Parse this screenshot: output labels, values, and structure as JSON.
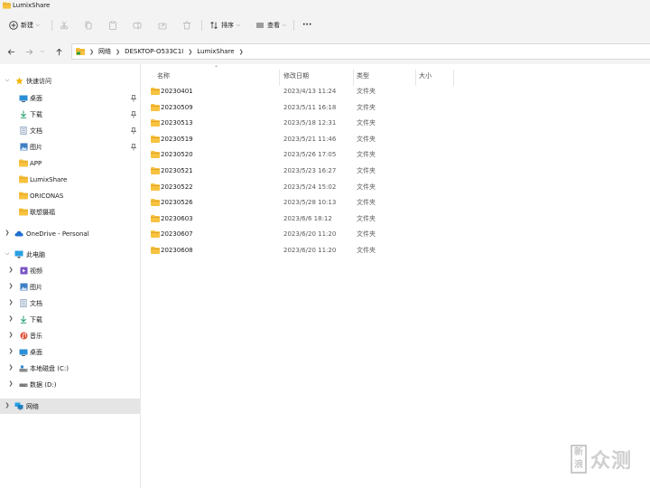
{
  "window": {
    "title": "LumixShare"
  },
  "toolbar": {
    "new_label": "新建",
    "sort_label": "排序",
    "view_label": "查看",
    "more_label": "···"
  },
  "address": {
    "crumbs": [
      "网络",
      "DESKTOP-O533C1I",
      "LumixShare"
    ]
  },
  "sidebar": {
    "quick_access": {
      "label": "快速访问",
      "items": [
        {
          "label": "桌面",
          "icon": "desktop-icon",
          "pinned": true
        },
        {
          "label": "下载",
          "icon": "download-icon",
          "pinned": true
        },
        {
          "label": "文档",
          "icon": "document-icon",
          "pinned": true
        },
        {
          "label": "图片",
          "icon": "picture-icon",
          "pinned": true
        },
        {
          "label": "APP",
          "icon": "folder-icon",
          "pinned": false
        },
        {
          "label": "LumixShare",
          "icon": "folder-icon",
          "pinned": false
        },
        {
          "label": "ORICONAS",
          "icon": "folder-icon",
          "pinned": false
        },
        {
          "label": "联想摄福",
          "icon": "folder-icon",
          "pinned": false
        }
      ]
    },
    "onedrive": {
      "label": "OneDrive - Personal"
    },
    "this_pc": {
      "label": "此电脑",
      "items": [
        {
          "label": "视频",
          "icon": "video-icon"
        },
        {
          "label": "图片",
          "icon": "picture-icon"
        },
        {
          "label": "文档",
          "icon": "document-icon"
        },
        {
          "label": "下载",
          "icon": "download-icon"
        },
        {
          "label": "音乐",
          "icon": "music-icon"
        },
        {
          "label": "桌面",
          "icon": "desktop-icon"
        },
        {
          "label": "本地磁盘 (C:)",
          "icon": "drive-icon"
        },
        {
          "label": "数据 (D:)",
          "icon": "drive-icon"
        }
      ]
    },
    "network": {
      "label": "网络"
    }
  },
  "columns": {
    "name": "名称",
    "date": "修改日期",
    "type": "类型",
    "size": "大小"
  },
  "files": [
    {
      "name": "20230401",
      "date": "2023/4/13 11:24",
      "type": "文件夹"
    },
    {
      "name": "20230509",
      "date": "2023/5/11 16:18",
      "type": "文件夹"
    },
    {
      "name": "20230513",
      "date": "2023/5/18 12:31",
      "type": "文件夹"
    },
    {
      "name": "20230519",
      "date": "2023/5/21 11:46",
      "type": "文件夹"
    },
    {
      "name": "20230520",
      "date": "2023/5/26 17:05",
      "type": "文件夹"
    },
    {
      "name": "20230521",
      "date": "2023/5/23 16:27",
      "type": "文件夹"
    },
    {
      "name": "20230522",
      "date": "2023/5/24 15:02",
      "type": "文件夹"
    },
    {
      "name": "20230526",
      "date": "2023/5/28 10:13",
      "type": "文件夹"
    },
    {
      "name": "20230603",
      "date": "2023/6/6 18:12",
      "type": "文件夹"
    },
    {
      "name": "20230607",
      "date": "2023/6/20 11:20",
      "type": "文件夹"
    },
    {
      "name": "20230608",
      "date": "2023/6/20 11:20",
      "type": "文件夹"
    }
  ],
  "watermark": {
    "square_text": "新浪",
    "text": "众测"
  },
  "colors": {
    "folder": "#f7c23e",
    "folder_dark": "#e2a42b",
    "accent": "#0078d4",
    "selection": "#e5e5e5"
  }
}
